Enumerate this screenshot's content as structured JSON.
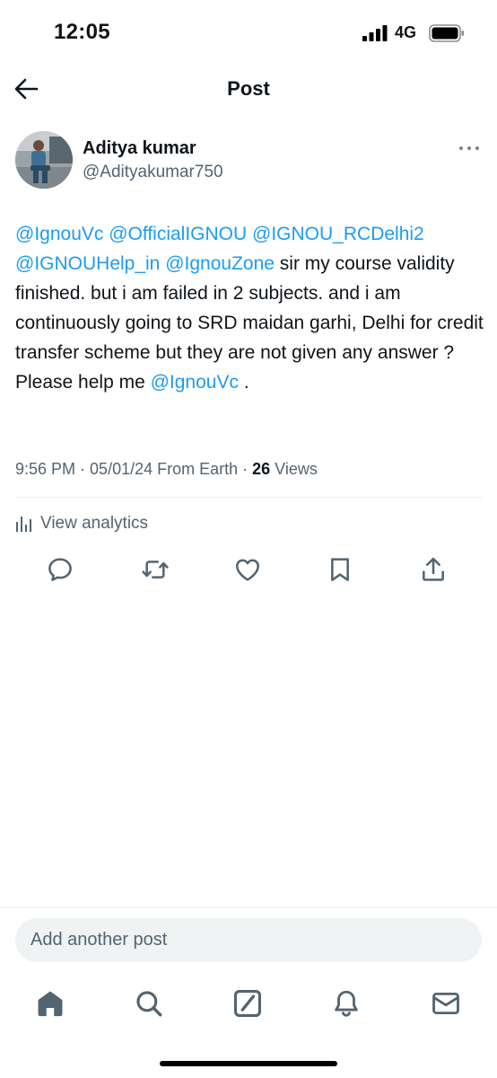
{
  "status_bar": {
    "time": "12:05",
    "network": "4G"
  },
  "header": {
    "title": "Post"
  },
  "author": {
    "name": "Aditya kumar",
    "handle": "@Adityakumar750"
  },
  "post": {
    "segments": [
      {
        "text": "@IgnouVc",
        "mention": true
      },
      {
        "text": " ",
        "mention": false
      },
      {
        "text": "@OfficialIGNOU",
        "mention": true
      },
      {
        "text": " ",
        "mention": false
      },
      {
        "text": "@IGNOU_RCDelhi2",
        "mention": true
      },
      {
        "text": " ",
        "mention": false
      },
      {
        "text": "@IGNOUHelp_in",
        "mention": true
      },
      {
        "text": " ",
        "mention": false
      },
      {
        "text": "@IgnouZone",
        "mention": true
      },
      {
        "text": " sir my course validity finished. but i am failed in 2 subjects. and i am continuously going to SRD maidan garhi, Delhi for credit transfer scheme but they are not given any answer ? Please help me ",
        "mention": false
      },
      {
        "text": "@IgnouVc",
        "mention": true
      },
      {
        "text": " .",
        "mention": false
      }
    ]
  },
  "meta": {
    "time": "9:56 PM",
    "separator": " · ",
    "date_location": "05/01/24 From Earth",
    "views_count": "26",
    "views_label": " Views"
  },
  "analytics": {
    "label": "View analytics",
    "icon": "bar-chart-icon"
  },
  "actions": [
    {
      "name": "reply",
      "icon": "comment-icon"
    },
    {
      "name": "repost",
      "icon": "repost-icon"
    },
    {
      "name": "like",
      "icon": "heart-icon"
    },
    {
      "name": "bookmark",
      "icon": "bookmark-icon"
    },
    {
      "name": "share",
      "icon": "share-icon"
    }
  ],
  "reply": {
    "placeholder": "Add another post"
  },
  "bottom_nav": [
    {
      "name": "home",
      "icon": "home-icon",
      "active": true
    },
    {
      "name": "search",
      "icon": "search-icon",
      "active": false
    },
    {
      "name": "grok",
      "icon": "grok-icon",
      "active": false
    },
    {
      "name": "notifications",
      "icon": "bell-icon",
      "active": false
    },
    {
      "name": "messages",
      "icon": "mail-icon",
      "active": false
    }
  ],
  "colors": {
    "accent": "#1d9bf0",
    "text": "#0f1419",
    "secondary": "#536471",
    "divider": "#e8ecef",
    "reply_bg": "#eff3f4"
  }
}
